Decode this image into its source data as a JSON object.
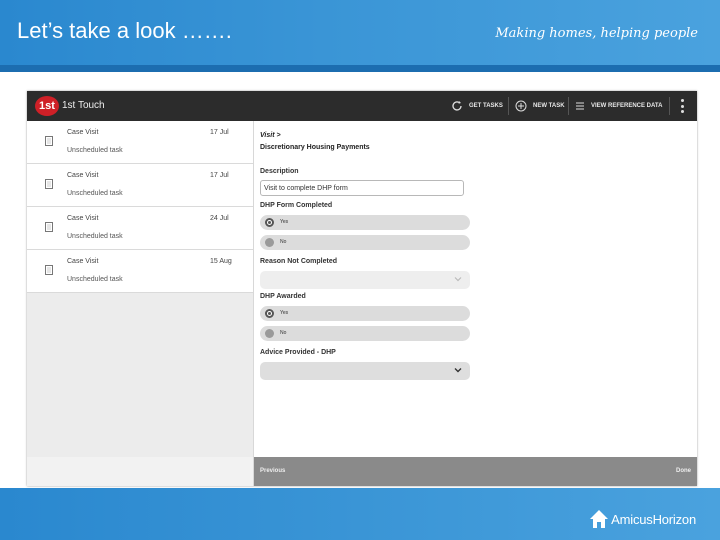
{
  "slide": {
    "title": "Let’s take a look …….",
    "tagline": "Making homes, helping people",
    "logo_text": "AmicusHorizon",
    "colors": {
      "header": "#2a88cf",
      "header_bar": "#1c6db0"
    }
  },
  "app": {
    "logo": "1st",
    "name": "1st Touch",
    "actions": {
      "get_tasks": "GET TASKS",
      "new_task": "NEW TASK",
      "view_reference": "VIEW REFERENCE DATA"
    },
    "icons": [
      "refresh-icon",
      "add-circle-icon",
      "list-icon",
      "more-vert-icon",
      "document-icon"
    ],
    "colors": {
      "app_bar": "#2c2c2c",
      "logo_red": "#cf2027"
    }
  },
  "tasks": [
    {
      "title": "Case Visit",
      "subtitle": "Unscheduled task",
      "date": "17 Jul"
    },
    {
      "title": "Case Visit",
      "subtitle": "Unscheduled task",
      "date": "17 Jul"
    },
    {
      "title": "Case Visit",
      "subtitle": "Unscheduled task",
      "date": "24 Jul"
    },
    {
      "title": "Case Visit",
      "subtitle": "Unscheduled task",
      "date": "15 Aug"
    }
  ],
  "form": {
    "breadcrumb": "Visit >",
    "heading": "Discretionary Housing Payments",
    "description_label": "Description",
    "description_value": "Visit to complete DHP form",
    "dhp_completed_label": "DHP Form Completed",
    "dhp_completed_options": [
      "Yes",
      "No"
    ],
    "dhp_completed_selected": "Yes",
    "reason_label": "Reason Not Completed",
    "reason_value": "",
    "dhp_awarded_label": "DHP Awarded",
    "dhp_awarded_options": [
      "Yes",
      "No"
    ],
    "dhp_awarded_selected": "Yes",
    "advice_label": "Advice Provided - DHP",
    "advice_value": ""
  },
  "footer": {
    "previous": "Previous",
    "done": "Done"
  }
}
